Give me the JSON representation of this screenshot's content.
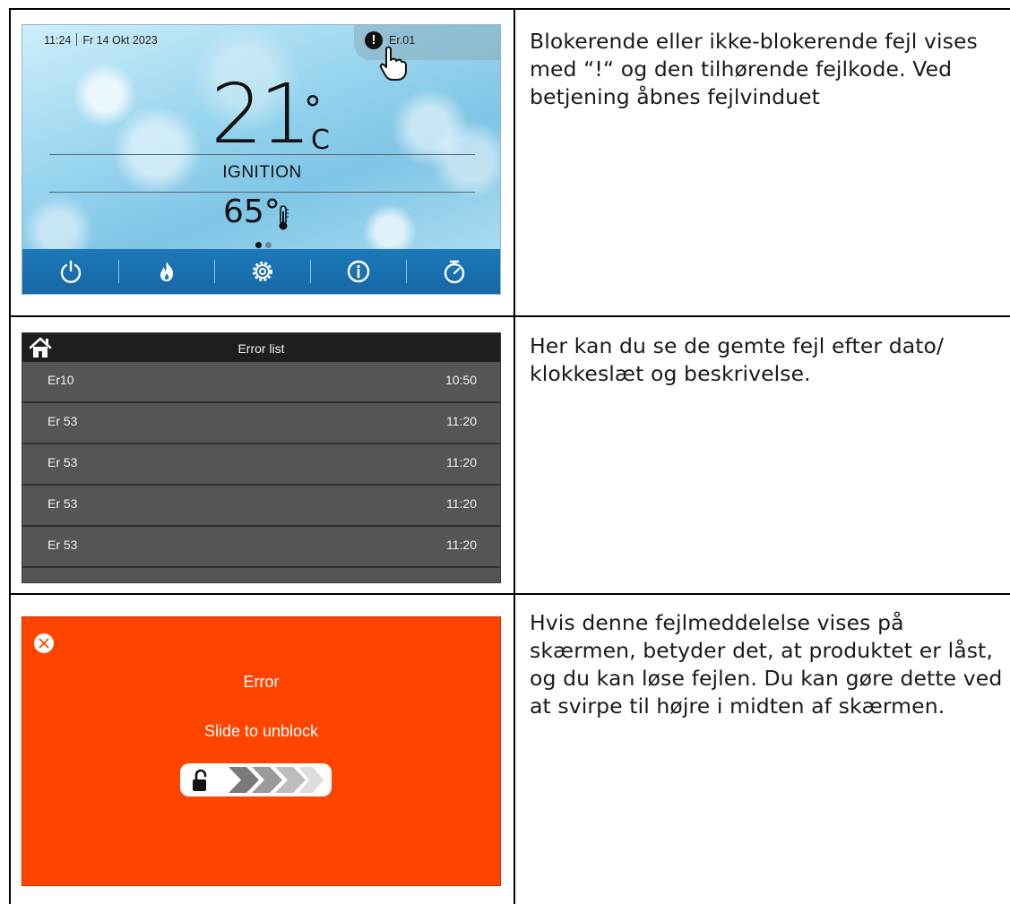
{
  "home_screen": {
    "time": "11:24",
    "date": "Fr 14 Okt 2023",
    "error_bang": "!",
    "error_code": "Er.01",
    "room_temp": "21",
    "room_temp_degree": "°",
    "room_temp_unit": "C",
    "state": "IGNITION",
    "water_temp": "65°",
    "nav_icons": [
      "power-icon",
      "flame-icon",
      "gear-icon",
      "info-icon",
      "timer-icon"
    ],
    "colors": {
      "nav_bar": "#1d78b8",
      "background": "#9ad6ef"
    }
  },
  "error_list_screen": {
    "title": "Error list",
    "rows": [
      {
        "code": "Er10",
        "time": "10:50"
      },
      {
        "code": "Er 53",
        "time": "11:20"
      },
      {
        "code": "Er 53",
        "time": "11:20"
      },
      {
        "code": "Er 53",
        "time": "11:20"
      },
      {
        "code": "Er 53",
        "time": "11:20"
      }
    ],
    "colors": {
      "header": "#1e1e1e",
      "rows": "#555555"
    }
  },
  "lock_screen": {
    "title": "Error",
    "hint": "Slide to unblock",
    "colors": {
      "background": "#ff4400"
    }
  },
  "descriptions": {
    "home": "Blokerende eller ikke-blokerende fejl vises med “!“ og den tilhørende fejlkode. Ved betjening åbnes fejlvinduet",
    "error_list": "Her kan du se de gemte fejl efter dato/ klokkeslæt og beskrivelse.",
    "lock": "Hvis denne fejlmeddelelse vises på skærmen, betyder det, at produktet er låst, og du kan løse fejlen. Du kan gøre dette ved at svirpe til højre i midten af skærmen."
  }
}
